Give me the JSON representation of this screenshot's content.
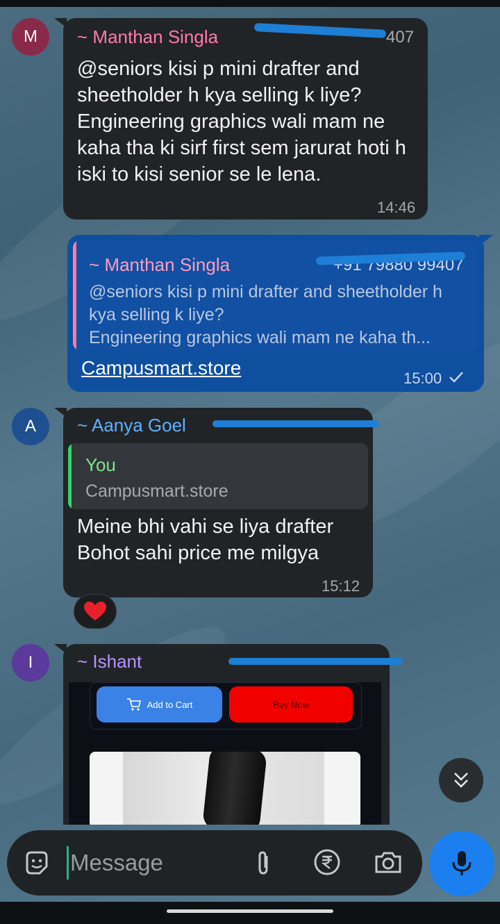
{
  "messages": [
    {
      "avatar_letter": "M",
      "avatar_color": "#8a2a4a",
      "sender": "~ Manthan Singla",
      "sender_color": "#ff7aa8",
      "phone_visible": "407",
      "text": "@seniors kisi p mini drafter and sheetholder h kya selling k liye?\nEngineering graphics wali mam ne kaha tha ki sirf first sem jarurat hoti h iski to kisi senior se le lena.",
      "time": "14:46"
    },
    {
      "outgoing": true,
      "quote_sender": "~ Manthan Singla",
      "quote_phone_visible": "+91 79880 99407",
      "quote_text": "@seniors kisi p mini drafter and sheetholder h kya selling k liye?\nEngineering graphics wali mam ne kaha th...",
      "link": "Campusmart.store",
      "time": "15:00",
      "status_icon": "single-check-icon"
    },
    {
      "avatar_letter": "A",
      "avatar_color": "#1e4f8f",
      "sender": "~ Aanya Goel",
      "sender_color": "#5eb0ff",
      "quote_sender": "You",
      "quote_text": "Campusmart.store",
      "text": "Meine bhi vahi se liya drafter\nBohot sahi price me milgya",
      "time": "15:12",
      "reaction": "heart-icon"
    },
    {
      "avatar_letter": "I",
      "avatar_color": "#5a3a9a",
      "sender": "~ Ishant",
      "sender_color": "#b394ff",
      "preview": {
        "add_to_cart": "Add to Cart",
        "buy_now": "Buy Now"
      }
    }
  ],
  "composer": {
    "placeholder": "Message",
    "icons": [
      "sticker-icon",
      "attach-icon",
      "rupee-payment-icon",
      "camera-icon",
      "mic-icon"
    ]
  },
  "colors": {
    "incoming_bubble": "#212427",
    "outgoing_bubble": "#0f4fa0",
    "accent_blue": "#1c7ff0"
  }
}
